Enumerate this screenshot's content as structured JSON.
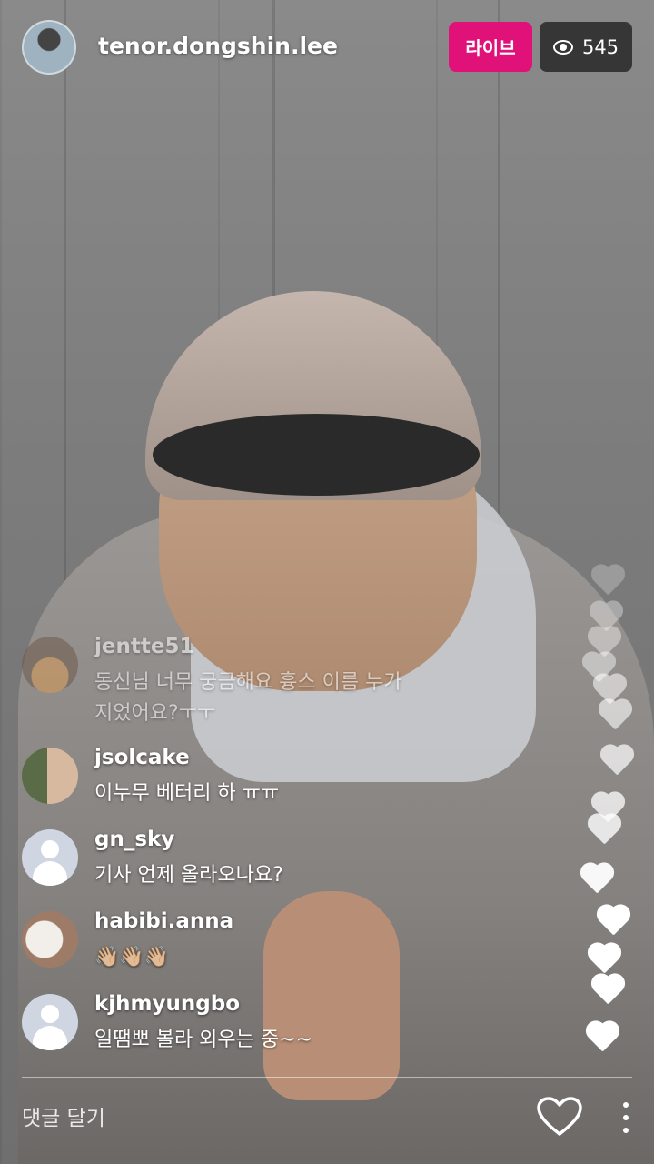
{
  "header": {
    "username": "tenor.dongshin.lee",
    "live_label": "라이브",
    "viewer_count": "545",
    "viewer_icon": "eye-icon"
  },
  "comments": [
    {
      "user": "jentte51",
      "text": "동신님 너무 궁금해요 흉스 이름 누가\n지었어요?ㅜㅜ"
    },
    {
      "user": "jsolcake",
      "text": "이누무 베터리 하 ㅠㅠ"
    },
    {
      "user": "gn_sky",
      "text": "기사 언제 올라오나요?"
    },
    {
      "user": "habibi.anna",
      "text": "👋🏼👋🏼👋🏼"
    },
    {
      "user": "kjhmyungbo",
      "text": "일땜뽀 볼라 외우는 중~~"
    }
  ],
  "footer": {
    "comment_placeholder": "댓글 달기",
    "like_icon": "heart-outline-icon",
    "more_icon": "more-vertical-icon"
  },
  "colors": {
    "live_badge": "#e0127a",
    "viewer_box": "#282828"
  }
}
